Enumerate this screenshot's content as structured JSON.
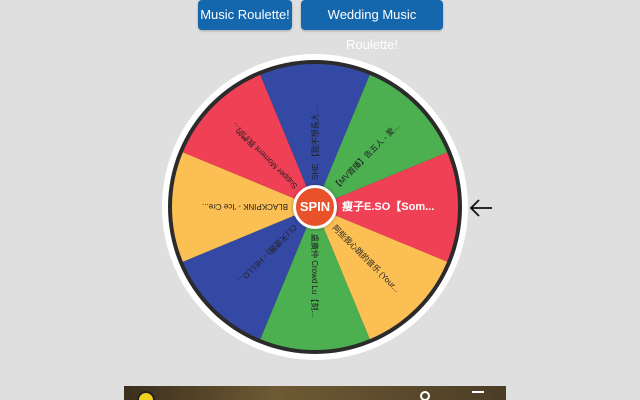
{
  "header": {
    "music_button": "Music Roulette!",
    "wedding_button": "Wedding Music Roulette!"
  },
  "wheel": {
    "spin_label": "SPIN",
    "segments": [
      {
        "label": "瘦子E.SO【Som...",
        "color": "#f04055",
        "active": true
      },
      {
        "label": "阿些我心跳的音乐 (Your...",
        "color": "#fbbf53",
        "active": false
      },
      {
        "label": "盧廣仲 Crowd Lu【刻...",
        "color": "#4caf50",
        "active": false
      },
      {
        "label": "CL(天使團) - HELLO...",
        "color": "#3449a3",
        "active": false
      },
      {
        "label": "BLACKPINK - 'Ice Cre...",
        "color": "#fbbf53",
        "active": false
      },
      {
        "label": "Supper Moment 我們的...",
        "color": "#f04055",
        "active": false
      },
      {
        "label": "SHE 【我不想長大...",
        "color": "#3449a3",
        "active": false
      },
      {
        "label": "【MV首播】告五人 - 愛...",
        "color": "#4caf50",
        "active": false
      }
    ],
    "ring_color": "#2b2b2b",
    "rim_color": "#ffffff"
  },
  "pointer": {
    "icon": "left-arrow-icon"
  },
  "video": {
    "logo_icon": "channel-logo-icon",
    "info_icon": "info-icon",
    "share_icon": "share-icon"
  }
}
